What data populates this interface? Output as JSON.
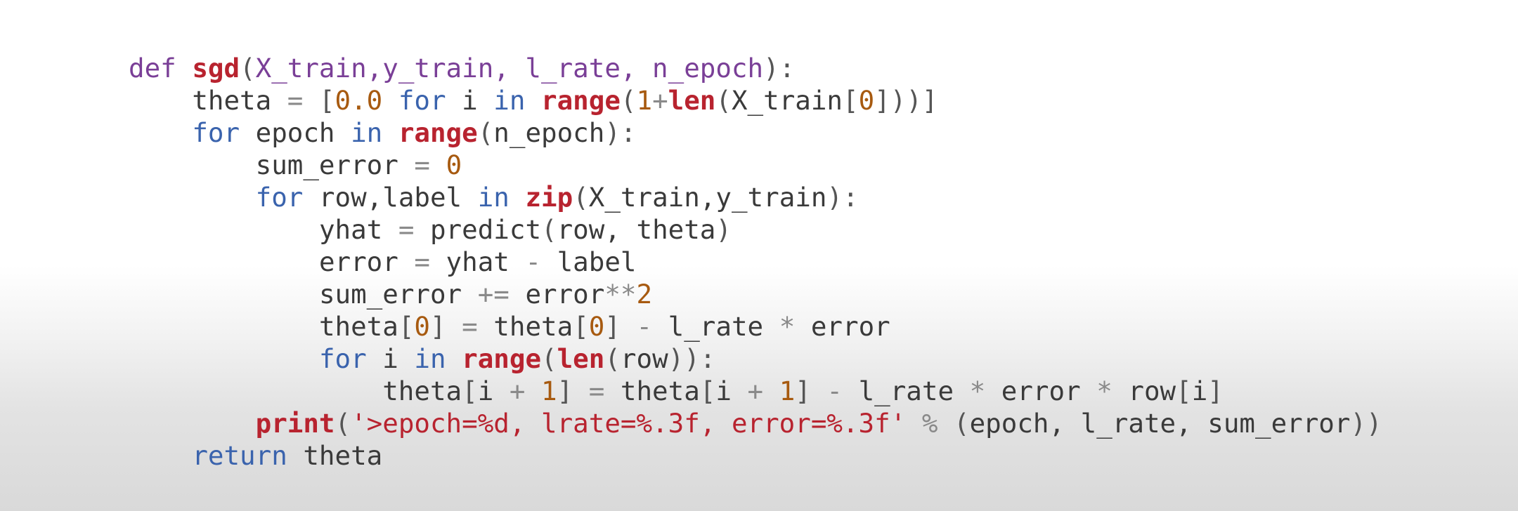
{
  "colors": {
    "keyword_def": "#7a3f97",
    "keyword_control": "#3a63ad",
    "builtin_function": "#b8232f",
    "number": "#a75a10",
    "string": "#b8232f",
    "operator": "#8a8a8a",
    "text": "#3a3a3a"
  },
  "code": {
    "language": "python",
    "lines": [
      {
        "indent": "",
        "tokens": [
          {
            "type": "kw",
            "text": "def "
          },
          {
            "type": "fn",
            "text": "sgd"
          },
          {
            "type": "punc",
            "text": "("
          },
          {
            "type": "param",
            "text": "X_train,y_train, l_rate, n_epoch"
          },
          {
            "type": "punc",
            "text": "):"
          }
        ]
      },
      {
        "indent": "    ",
        "tokens": [
          {
            "type": "txt",
            "text": "theta "
          },
          {
            "type": "op",
            "text": "="
          },
          {
            "type": "txt",
            "text": " "
          },
          {
            "type": "punc",
            "text": "["
          },
          {
            "type": "num",
            "text": "0.0"
          },
          {
            "type": "txt",
            "text": " "
          },
          {
            "type": "ctrl",
            "text": "for"
          },
          {
            "type": "txt",
            "text": " i "
          },
          {
            "type": "ctrl",
            "text": "in"
          },
          {
            "type": "txt",
            "text": " "
          },
          {
            "type": "fn",
            "text": "range"
          },
          {
            "type": "punc",
            "text": "("
          },
          {
            "type": "num",
            "text": "1"
          },
          {
            "type": "op",
            "text": "+"
          },
          {
            "type": "fn",
            "text": "len"
          },
          {
            "type": "punc",
            "text": "("
          },
          {
            "type": "txt",
            "text": "X_train"
          },
          {
            "type": "punc",
            "text": "["
          },
          {
            "type": "num",
            "text": "0"
          },
          {
            "type": "punc",
            "text": "]))]"
          }
        ]
      },
      {
        "indent": "    ",
        "tokens": [
          {
            "type": "ctrl",
            "text": "for"
          },
          {
            "type": "txt",
            "text": " epoch "
          },
          {
            "type": "ctrl",
            "text": "in"
          },
          {
            "type": "txt",
            "text": " "
          },
          {
            "type": "fn",
            "text": "range"
          },
          {
            "type": "punc",
            "text": "("
          },
          {
            "type": "txt",
            "text": "n_epoch"
          },
          {
            "type": "punc",
            "text": "):"
          }
        ]
      },
      {
        "indent": "        ",
        "tokens": [
          {
            "type": "txt",
            "text": "sum_error "
          },
          {
            "type": "op",
            "text": "="
          },
          {
            "type": "txt",
            "text": " "
          },
          {
            "type": "num",
            "text": "0"
          }
        ]
      },
      {
        "indent": "        ",
        "tokens": [
          {
            "type": "ctrl",
            "text": "for"
          },
          {
            "type": "txt",
            "text": " row,label "
          },
          {
            "type": "ctrl",
            "text": "in"
          },
          {
            "type": "txt",
            "text": " "
          },
          {
            "type": "fn",
            "text": "zip"
          },
          {
            "type": "punc",
            "text": "("
          },
          {
            "type": "txt",
            "text": "X_train,y_train"
          },
          {
            "type": "punc",
            "text": "):"
          }
        ]
      },
      {
        "indent": "            ",
        "tokens": [
          {
            "type": "txt",
            "text": "yhat "
          },
          {
            "type": "op",
            "text": "="
          },
          {
            "type": "txt",
            "text": " predict"
          },
          {
            "type": "punc",
            "text": "("
          },
          {
            "type": "txt",
            "text": "row, theta"
          },
          {
            "type": "punc",
            "text": ")"
          }
        ]
      },
      {
        "indent": "            ",
        "tokens": [
          {
            "type": "txt",
            "text": "error "
          },
          {
            "type": "op",
            "text": "="
          },
          {
            "type": "txt",
            "text": " yhat "
          },
          {
            "type": "op",
            "text": "-"
          },
          {
            "type": "txt",
            "text": " label"
          }
        ]
      },
      {
        "indent": "            ",
        "tokens": [
          {
            "type": "txt",
            "text": "sum_error "
          },
          {
            "type": "op",
            "text": "+="
          },
          {
            "type": "txt",
            "text": " error"
          },
          {
            "type": "op",
            "text": "**"
          },
          {
            "type": "num",
            "text": "2"
          }
        ]
      },
      {
        "indent": "            ",
        "tokens": [
          {
            "type": "txt",
            "text": "theta"
          },
          {
            "type": "punc",
            "text": "["
          },
          {
            "type": "num",
            "text": "0"
          },
          {
            "type": "punc",
            "text": "]"
          },
          {
            "type": "txt",
            "text": " "
          },
          {
            "type": "op",
            "text": "="
          },
          {
            "type": "txt",
            "text": " theta"
          },
          {
            "type": "punc",
            "text": "["
          },
          {
            "type": "num",
            "text": "0"
          },
          {
            "type": "punc",
            "text": "]"
          },
          {
            "type": "txt",
            "text": " "
          },
          {
            "type": "op",
            "text": "-"
          },
          {
            "type": "txt",
            "text": " l_rate "
          },
          {
            "type": "op",
            "text": "*"
          },
          {
            "type": "txt",
            "text": " error"
          }
        ]
      },
      {
        "indent": "            ",
        "tokens": [
          {
            "type": "ctrl",
            "text": "for"
          },
          {
            "type": "txt",
            "text": " i "
          },
          {
            "type": "ctrl",
            "text": "in"
          },
          {
            "type": "txt",
            "text": " "
          },
          {
            "type": "fn",
            "text": "range"
          },
          {
            "type": "punc",
            "text": "("
          },
          {
            "type": "fn",
            "text": "len"
          },
          {
            "type": "punc",
            "text": "("
          },
          {
            "type": "txt",
            "text": "row"
          },
          {
            "type": "punc",
            "text": ")):"
          }
        ]
      },
      {
        "indent": "                ",
        "tokens": [
          {
            "type": "txt",
            "text": "theta"
          },
          {
            "type": "punc",
            "text": "["
          },
          {
            "type": "txt",
            "text": "i "
          },
          {
            "type": "op",
            "text": "+"
          },
          {
            "type": "txt",
            "text": " "
          },
          {
            "type": "num",
            "text": "1"
          },
          {
            "type": "punc",
            "text": "]"
          },
          {
            "type": "txt",
            "text": " "
          },
          {
            "type": "op",
            "text": "="
          },
          {
            "type": "txt",
            "text": " theta"
          },
          {
            "type": "punc",
            "text": "["
          },
          {
            "type": "txt",
            "text": "i "
          },
          {
            "type": "op",
            "text": "+"
          },
          {
            "type": "txt",
            "text": " "
          },
          {
            "type": "num",
            "text": "1"
          },
          {
            "type": "punc",
            "text": "]"
          },
          {
            "type": "txt",
            "text": " "
          },
          {
            "type": "op",
            "text": "-"
          },
          {
            "type": "txt",
            "text": " l_rate "
          },
          {
            "type": "op",
            "text": "*"
          },
          {
            "type": "txt",
            "text": " error "
          },
          {
            "type": "op",
            "text": "*"
          },
          {
            "type": "txt",
            "text": " row"
          },
          {
            "type": "punc",
            "text": "["
          },
          {
            "type": "txt",
            "text": "i"
          },
          {
            "type": "punc",
            "text": "]"
          }
        ]
      },
      {
        "indent": "        ",
        "tokens": [
          {
            "type": "fn",
            "text": "print"
          },
          {
            "type": "punc",
            "text": "("
          },
          {
            "type": "str",
            "text": "'>epoch=%d, lrate=%.3f, error=%.3f'"
          },
          {
            "type": "txt",
            "text": " "
          },
          {
            "type": "op",
            "text": "%"
          },
          {
            "type": "txt",
            "text": " "
          },
          {
            "type": "punc",
            "text": "("
          },
          {
            "type": "txt",
            "text": "epoch, l_rate, sum_error"
          },
          {
            "type": "punc",
            "text": "))"
          }
        ]
      },
      {
        "indent": "    ",
        "tokens": [
          {
            "type": "ctrl",
            "text": "return"
          },
          {
            "type": "txt",
            "text": " theta"
          }
        ]
      }
    ]
  }
}
